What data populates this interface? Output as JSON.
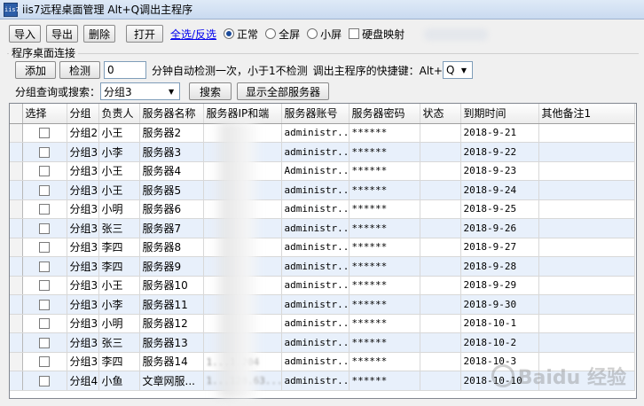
{
  "window": {
    "title": "iis7远程桌面管理 Alt+Q调出主程序",
    "icon_label": "iis7"
  },
  "toolbar": {
    "import": "导入",
    "export": "导出",
    "delete": "删除",
    "open": "打开",
    "select_all": "全选/反选",
    "mode_normal": "正常",
    "mode_fullscreen": "全屏",
    "mode_small": "小屏",
    "disk_mapping": "硬盘映射"
  },
  "connection": {
    "group_label": "程序桌面连接",
    "add": "添加",
    "detect": "检测",
    "interval_value": "0",
    "interval_hint": "分钟自动检测一次，小于1不检测",
    "hotkey_label": "调出主程序的快捷键：Alt+",
    "hotkey_value": "Q"
  },
  "search": {
    "label": "分组查询或搜索：",
    "value": "分组3",
    "search_button": "搜索",
    "show_all_button": "显示全部服务器"
  },
  "table": {
    "headers": [
      "选择",
      "分组",
      "负责人",
      "服务器名称",
      "服务器IP和端",
      "服务器账号",
      "服务器密码",
      "状态",
      "到期时间",
      "其他备注1"
    ],
    "rows": [
      {
        "group": "分组2",
        "owner": "小王",
        "name": "服务器2",
        "ip": "",
        "account": "administr...",
        "password": "******",
        "status": "",
        "expiry": "2018-9-21",
        "note": ""
      },
      {
        "group": "分组3",
        "owner": "小李",
        "name": "服务器3",
        "ip": "",
        "account": "administr...",
        "password": "******",
        "status": "",
        "expiry": "2018-9-22",
        "note": ""
      },
      {
        "group": "分组3",
        "owner": "小王",
        "name": "服务器4",
        "ip": "",
        "account": "Administr...",
        "password": "******",
        "status": "",
        "expiry": "2018-9-23",
        "note": ""
      },
      {
        "group": "分组3",
        "owner": "小王",
        "name": "服务器5",
        "ip": "",
        "account": "administr...",
        "password": "******",
        "status": "",
        "expiry": "2018-9-24",
        "note": ""
      },
      {
        "group": "分组3",
        "owner": "小明",
        "name": "服务器6",
        "ip": "",
        "account": "administr...",
        "password": "******",
        "status": "",
        "expiry": "2018-9-25",
        "note": ""
      },
      {
        "group": "分组3",
        "owner": "张三",
        "name": "服务器7",
        "ip": "",
        "account": "administr...",
        "password": "******",
        "status": "",
        "expiry": "2018-9-26",
        "note": ""
      },
      {
        "group": "分组3",
        "owner": "李四",
        "name": "服务器8",
        "ip": "",
        "account": "administr...",
        "password": "******",
        "status": "",
        "expiry": "2018-9-27",
        "note": ""
      },
      {
        "group": "分组3",
        "owner": "李四",
        "name": "服务器9",
        "ip": "",
        "account": "administr...",
        "password": "******",
        "status": "",
        "expiry": "2018-9-28",
        "note": ""
      },
      {
        "group": "分组3",
        "owner": "小王",
        "name": "服务器10",
        "ip": "",
        "account": "administr...",
        "password": "******",
        "status": "",
        "expiry": "2018-9-29",
        "note": ""
      },
      {
        "group": "分组3",
        "owner": "小李",
        "name": "服务器11",
        "ip": "",
        "account": "administr...",
        "password": "******",
        "status": "",
        "expiry": "2018-9-30",
        "note": ""
      },
      {
        "group": "分组3",
        "owner": "小明",
        "name": "服务器12",
        "ip": "",
        "account": "administr...",
        "password": "******",
        "status": "",
        "expiry": "2018-10-1",
        "note": ""
      },
      {
        "group": "分组3",
        "owner": "张三",
        "name": "服务器13",
        "ip": "",
        "account": "administr...",
        "password": "******",
        "status": "",
        "expiry": "2018-10-2",
        "note": ""
      },
      {
        "group": "分组3",
        "owner": "李四",
        "name": "服务器14",
        "ip": "1...1.204",
        "account": "administr...",
        "password": "******",
        "status": "",
        "expiry": "2018-10-3",
        "note": ""
      },
      {
        "group": "分组4",
        "owner": "小鱼",
        "name": "文章网服...",
        "ip": "1...128.63...",
        "account": "administr...",
        "password": "******",
        "status": "",
        "expiry": "2018-10-10",
        "note": ""
      }
    ]
  },
  "watermark": {
    "text": "Baidu 经验"
  },
  "icons": {
    "app": "app-icon",
    "dropdown": "chevron-down-icon"
  }
}
